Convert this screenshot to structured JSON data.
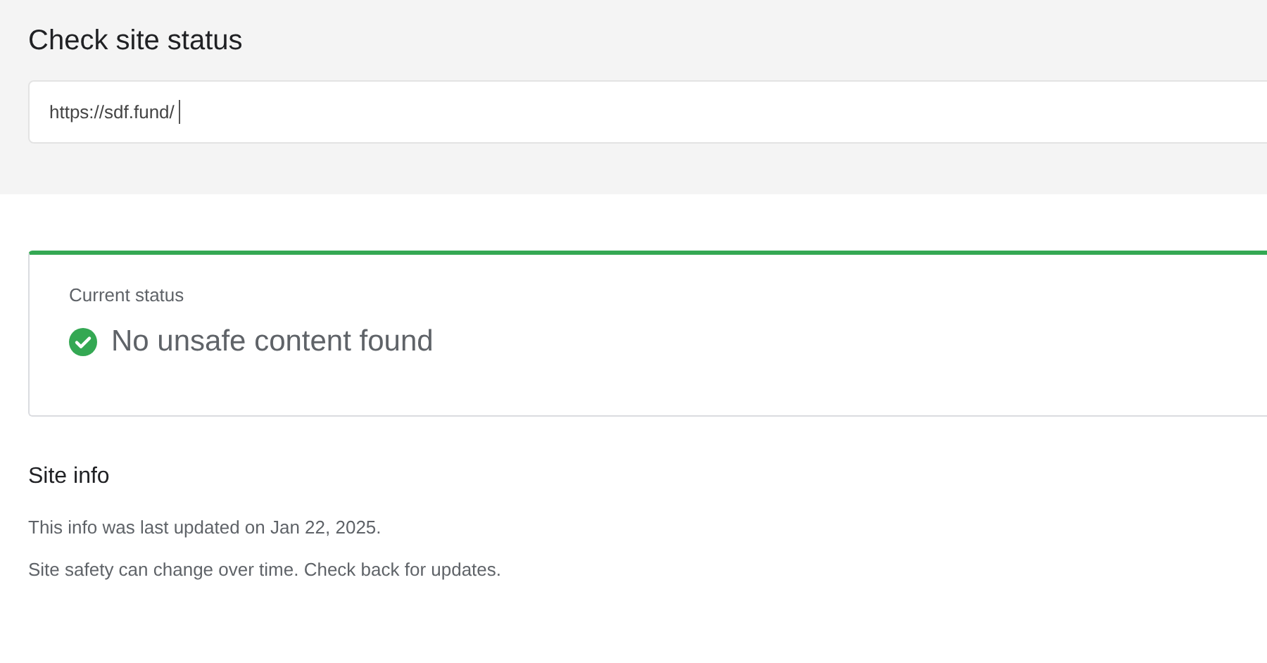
{
  "page": {
    "title": "Check site status"
  },
  "url_field": {
    "value": "https://sdf.fund/",
    "focused": true
  },
  "status_card": {
    "label": "Current status",
    "kind": "safe",
    "message": "No unsafe content found"
  },
  "site_info": {
    "title": "Site info",
    "lines": [
      "This info was last updated on Jan 22, 2025.",
      "Site safety can change over time. Check back for updates."
    ]
  }
}
